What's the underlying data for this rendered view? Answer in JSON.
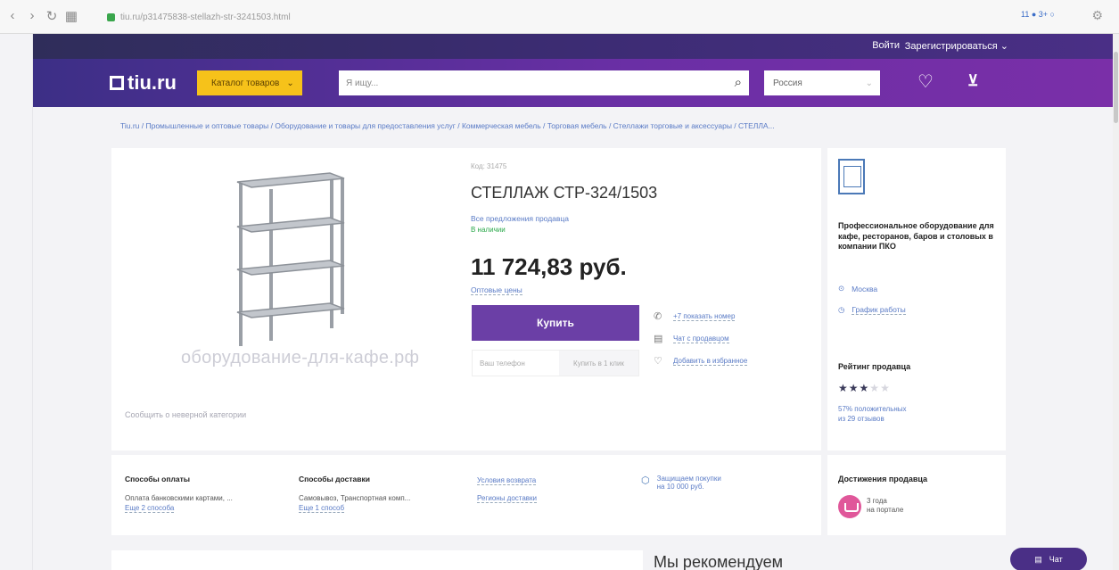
{
  "browser": {
    "nav_icons": [
      "chevron-left-icon",
      "chevron-right-icon",
      "reload-icon",
      "apps-icon"
    ],
    "url": "tiu.ru/p31475838-stellazh-str-3241503.html",
    "right_indicator": "11 ● 3+ ○",
    "extension_icon": "extension-icon"
  },
  "header": {
    "login": "Войти",
    "register": "Зарегистрироваться",
    "logo_text": "tiu.ru",
    "catalog": "Каталог товаров",
    "search_placeholder": "Я ищу...",
    "region": "Россия"
  },
  "breadcrumb": "Tiu.ru / Промышленные и оптовые товары / Оборудование и товары для предоставления услуг / Коммерческая мебель / Торговая мебель / Стеллажи торговые и аксессуары / СТЕЛЛА...",
  "product": {
    "code": "Код: 31475",
    "title": "СТЕЛЛАЖ СТР-324/1503",
    "all_offers": "Все предложения продавца",
    "availability": "В наличии",
    "price": "11 724,83 руб.",
    "wholesale": "Оптовые цены",
    "buy_label": "Купить",
    "phone_placeholder": "Ваш телефон",
    "one_click": "Купить в 1 клик",
    "show_number": "+7 показать номер",
    "chat_seller": "Чат с продавцом",
    "add_favorites": "Добавить в избранное",
    "watermark": "оборудование-для-кафе.рф",
    "report_category": "Сообщить о неверной категории"
  },
  "seller": {
    "description": "Профессиональное оборудование для кафе, ресторанов, баров и столовых в компании ПКО",
    "location": "Москва",
    "schedule": "График работы",
    "rating_title": "Рейтинг продавца",
    "rating": 3,
    "rating_max": 5,
    "positive_line1": "57% положительных",
    "positive_line2": "из 29 отзывов"
  },
  "info": {
    "payment_title": "Способы оплаты",
    "payment_text": "Оплата банковскими картами, ...",
    "payment_more": "Еще 2 способа",
    "delivery_title": "Способы доставки",
    "delivery_text": "Самовывоз, Транспортная комп...",
    "delivery_more": "Еще 1 способ",
    "return_terms": "Условия возврата",
    "delivery_regions": "Регионы доставки",
    "protection_line1": "Защищаем покупки",
    "protection_line2": "на 10 000 руб."
  },
  "achievements": {
    "title": "Достижения продавца",
    "years": "3 года",
    "on_portal": "на портале"
  },
  "recommend": "Мы рекомендуем",
  "chat_label": "Чат"
}
